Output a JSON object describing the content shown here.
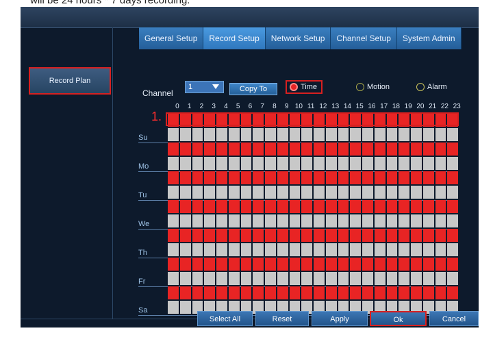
{
  "caption": "will be 24 hours * 7 days recording.",
  "tabs": [
    {
      "label": "General Setup"
    },
    {
      "label": "Record Setup"
    },
    {
      "label": "Network Setup"
    },
    {
      "label": "Channel Setup"
    },
    {
      "label": "System Admin"
    }
  ],
  "active_tab": "Record Setup",
  "sidebar": {
    "record_plan": "Record Plan"
  },
  "channel": {
    "label": "Channel",
    "value": "1"
  },
  "copy_to": "Copy To",
  "modes": {
    "time": "Time",
    "motion": "Motion",
    "alarm": "Alarm"
  },
  "step_label": "1.",
  "hours": [
    "0",
    "1",
    "2",
    "3",
    "4",
    "5",
    "6",
    "7",
    "8",
    "9",
    "10",
    "11",
    "12",
    "13",
    "14",
    "15",
    "16",
    "17",
    "18",
    "19",
    "20",
    "21",
    "22",
    "23"
  ],
  "days": [
    "Su",
    "Mo",
    "Tu",
    "We",
    "Th",
    "Fr",
    "Sa"
  ],
  "schedule": {
    "rows": 14,
    "cols": 24,
    "red_rows": [
      0,
      2,
      4,
      6,
      8,
      10,
      12
    ],
    "colors": {
      "recorded": "#e82424",
      "empty": "#c8c8c8"
    }
  },
  "buttons": {
    "select_all": "Select All",
    "reset": "Reset",
    "apply": "Apply",
    "ok": "Ok",
    "cancel": "Cancel"
  }
}
